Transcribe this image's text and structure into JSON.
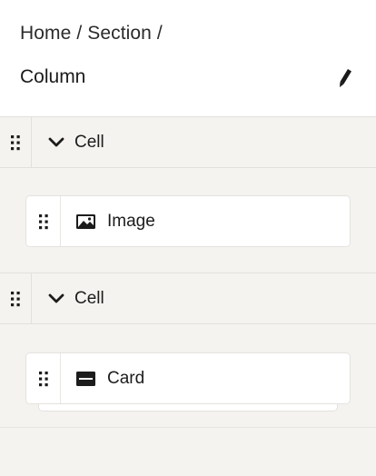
{
  "breadcrumb": {
    "text": "Home / Section /"
  },
  "title": "Column",
  "cells": [
    {
      "label": "Cell",
      "block": {
        "label": "Image",
        "icon": "image-icon"
      }
    },
    {
      "label": "Cell",
      "block": {
        "label": "Card",
        "icon": "card-icon"
      }
    }
  ],
  "icons": {
    "edit": "pencil-icon",
    "drag": "drag-handle-icon",
    "toggle": "chevron-down-icon"
  },
  "colors": {
    "background": "#f4f3f0",
    "surface": "#ffffff",
    "border": "#e2e0dc",
    "text": "#1c1c1c"
  }
}
